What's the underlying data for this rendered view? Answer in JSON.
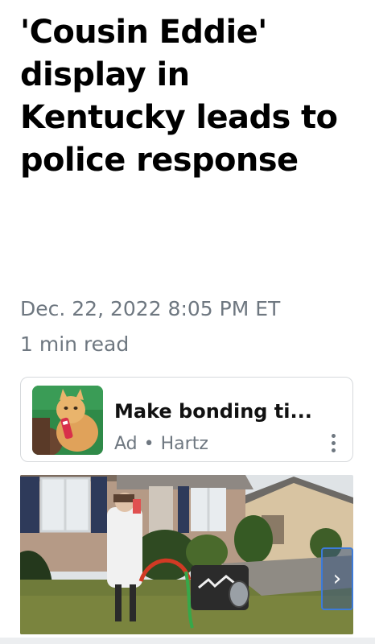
{
  "article": {
    "headline": "'Cousin Eddie' display in Kentucky leads to police response",
    "timestamp": "Dec. 22, 2022 8:05 PM ET",
    "read_time": "1 min read"
  },
  "ad": {
    "title": "Make bonding ti...",
    "label": "Ad",
    "advertiser": "Hartz"
  },
  "icons": {
    "ad_menu": "more-vertical-icon",
    "carousel_next": "chevron-right-icon"
  },
  "colors": {
    "meta_text": "#6e7780",
    "card_border": "#d6d9dc",
    "focus_blue": "#3d7bd9"
  }
}
